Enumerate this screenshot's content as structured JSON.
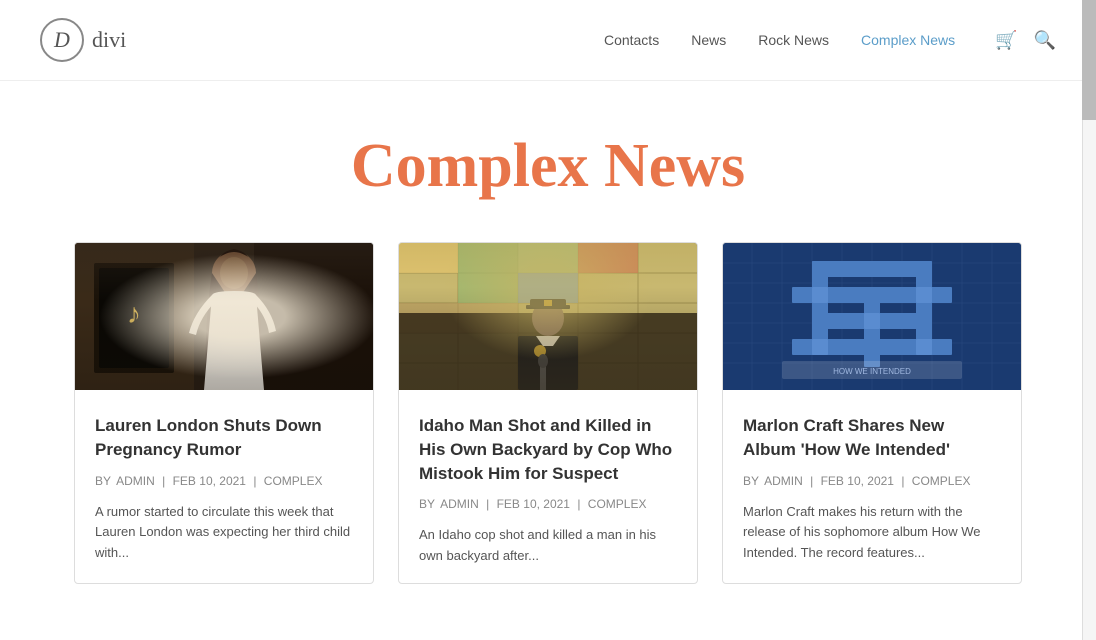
{
  "site": {
    "logo_letter": "D",
    "logo_name": "divi"
  },
  "nav": {
    "items": [
      {
        "label": "Contacts",
        "href": "#",
        "active": false
      },
      {
        "label": "News",
        "href": "#",
        "active": false
      },
      {
        "label": "Rock News",
        "href": "#",
        "active": false
      },
      {
        "label": "Complex News",
        "href": "#",
        "active": true
      }
    ],
    "cart_icon": "🛒",
    "search_icon": "🔍"
  },
  "page": {
    "title": "Complex News"
  },
  "cards": [
    {
      "id": "card-1",
      "title": "Lauren London Shuts Down Pregnancy Rumor",
      "author": "ADMIN",
      "date": "FEB 10, 2021",
      "category": "COMPLEX",
      "excerpt": "A rumor started to circulate this week that Lauren London was expecting her third child with..."
    },
    {
      "id": "card-2",
      "title": "Idaho Man Shot and Killed in His Own Backyard by Cop Who Mistook Him for Suspect",
      "author": "ADMIN",
      "date": "FEB 10, 2021",
      "category": "COMPLEX",
      "excerpt": "An Idaho cop shot and killed a man in his own backyard after..."
    },
    {
      "id": "card-3",
      "title": "Marlon Craft Shares New Album 'How We Intended'",
      "author": "ADMIN",
      "date": "FEB 10, 2021",
      "category": "COMPLEX",
      "excerpt": "Marlon Craft makes his return with the release of his sophomore album How We Intended. The record features..."
    }
  ],
  "meta_separator": "|"
}
